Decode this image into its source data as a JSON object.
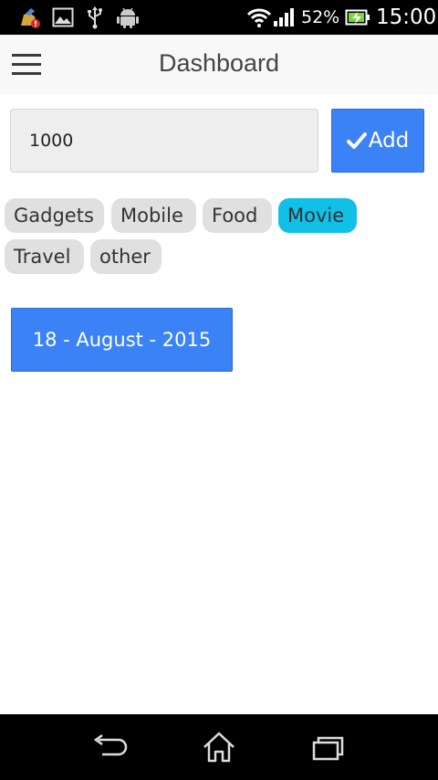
{
  "status_bar": {
    "battery_percent": "52%",
    "time": "15:00",
    "icons": [
      "app-notification-icon",
      "image-icon",
      "usb-icon",
      "android-icon",
      "wifi-icon",
      "signal-icon",
      "battery-charging-icon"
    ]
  },
  "toolbar": {
    "title": "Dashboard",
    "menu_icon": "hamburger-menu-icon"
  },
  "form": {
    "amount_value": "1000",
    "add_label": "Add",
    "add_icon": "check-icon"
  },
  "categories": [
    {
      "label": "Gadgets",
      "active": false
    },
    {
      "label": "Mobile",
      "active": false
    },
    {
      "label": "Food",
      "active": false
    },
    {
      "label": "Movie",
      "active": true
    },
    {
      "label": "Travel",
      "active": false
    },
    {
      "label": "other",
      "active": false
    }
  ],
  "date_button": {
    "label": "18 - August - 2015"
  },
  "nav_bar": {
    "icons": [
      "back-icon",
      "home-icon",
      "recent-apps-icon"
    ]
  },
  "colors": {
    "primary": "#3b82f6",
    "active_chip": "#11c0e6",
    "chip": "#e0e0e0"
  }
}
